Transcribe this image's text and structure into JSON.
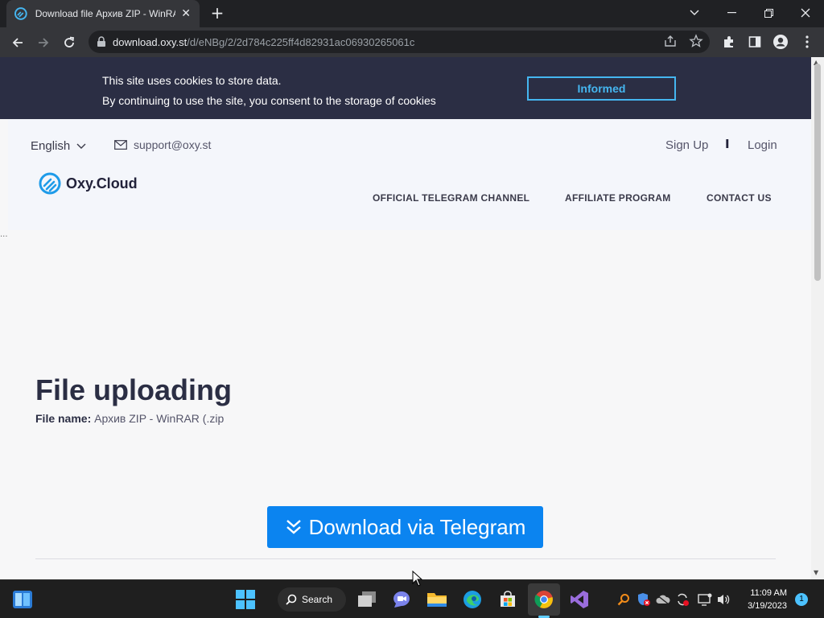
{
  "browser": {
    "tab_title": "Download file Архив ZIP - WinRAR (.zip",
    "url_host": "download.oxy.st",
    "url_path": "/d/eNBg/2/2d784c225ff4d82931ac06930265061c"
  },
  "cookie": {
    "line1": "This site uses cookies to store data.",
    "line2": "By continuing to use the site, you consent to the storage of cookies",
    "button": "Informed"
  },
  "header": {
    "language": "English",
    "email": "support@oxy.st",
    "logo": "Oxy.Cloud",
    "sign_up": "Sign Up",
    "separator": "I",
    "login": "Login",
    "nav": [
      "OFFICIAL TELEGRAM CHANNEL",
      "AFFILIATE PROGRAM",
      "CONTACT US"
    ]
  },
  "main": {
    "ellipsis": "...",
    "title": "File uploading",
    "file_name_label": "File name:",
    "file_name_value": "Архив ZIP - WinRAR (.zip",
    "download_button": "Download via Telegram"
  },
  "taskbar": {
    "search": "Search",
    "time": "11:09 AM",
    "date": "3/19/2023",
    "notifications": "1"
  },
  "colors": {
    "cookie_bg": "#2b2e44",
    "accent": "#0b84f0",
    "cookie_button": "#45b6f0"
  }
}
